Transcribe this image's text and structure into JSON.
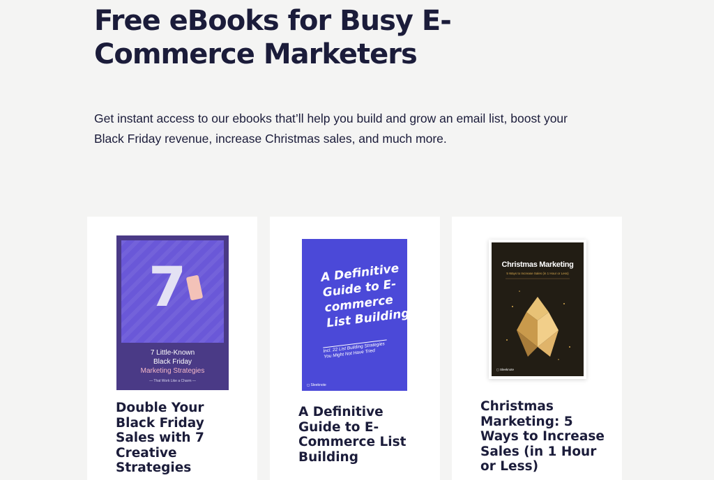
{
  "header": {
    "title": "Free eBooks for Busy E-Commerce Marketers",
    "intro": "Get instant access to our ebooks that’ll help you build and grow an email list, boost your Black Friday revenue, increase Christmas sales, and much more."
  },
  "cards": [
    {
      "title": "Double Your Black Friday Sales with 7 Creative Strategies",
      "cover": {
        "number": "7",
        "line1": "7 Little-Known",
        "line2": "Black Friday",
        "line3": "Marketing Strategies",
        "subtitle": "— That Work Like a Charm —"
      }
    },
    {
      "title": "A Definitive Guide to E-Commerce List Building",
      "cover": {
        "heading": "A Definitive Guide to E-commerce List Building",
        "subtitle": "Incl. 22 List Building Strategies You Might Not Have Tried",
        "logo": "Sleeknote"
      }
    },
    {
      "title": "Christmas Marketing: 5 Ways to Increase Sales (in 1 Hour or Less)",
      "cover": {
        "heading": "Christmas Marketing",
        "subtitle": "5 Ways to Increase Sales (in 1 Hour or Less)",
        "logo": "Sleeknote"
      }
    }
  ],
  "colors": {
    "background": "#f4f4f3",
    "text": "#1b1c3a",
    "cover1": "#4a3a86",
    "cover2": "#4b49d8",
    "cover3": "#221d14",
    "gold": "#d7a94f"
  }
}
